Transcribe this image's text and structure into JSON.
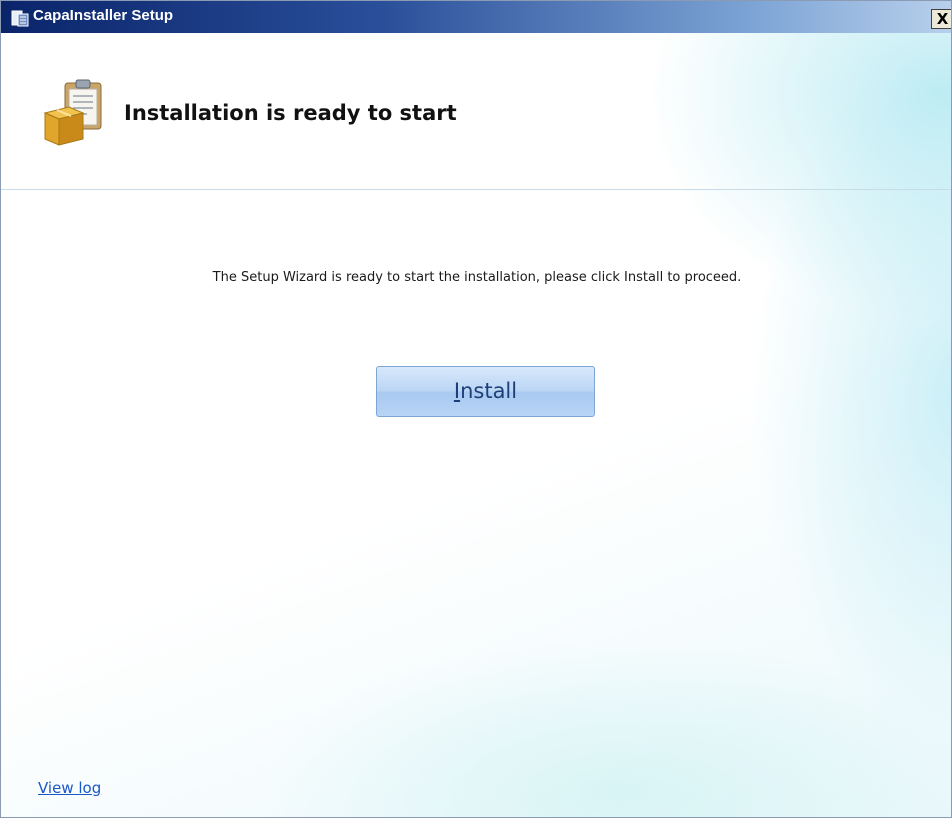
{
  "window": {
    "title": "CapaInstaller Setup",
    "close_label": "X",
    "icon": "installer-app-icon"
  },
  "header": {
    "title": "Installation is ready to start",
    "icon": "package-clipboard-icon"
  },
  "main": {
    "instruction": "The Setup Wizard is ready to start the installation, please click Install to proceed.",
    "install_button": {
      "mnemonic": "I",
      "rest": "nstall"
    }
  },
  "footer": {
    "view_log_label": "View log"
  },
  "colors": {
    "titlebar_start": "#0a246a",
    "button_fill": "#bcd6f5",
    "link": "#1a57c7"
  }
}
